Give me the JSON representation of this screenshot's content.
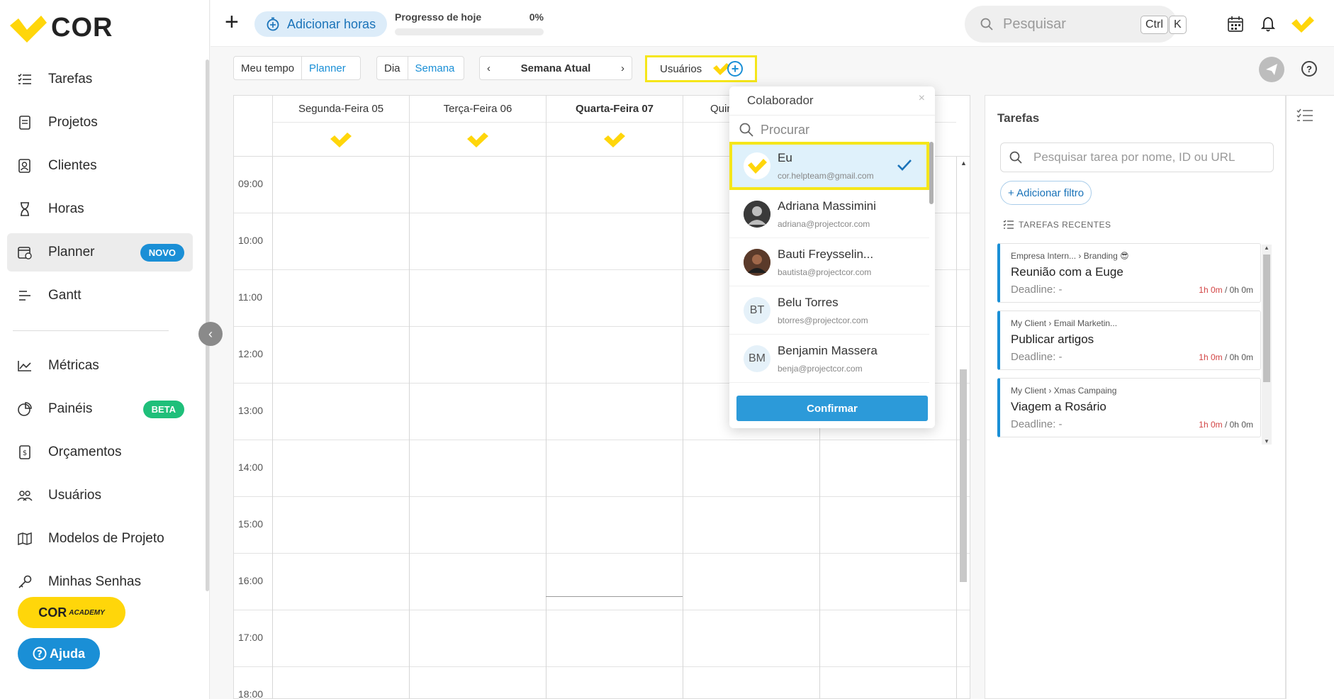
{
  "brand": {
    "name": "COR",
    "accent": "#ffd60a",
    "blue": "#1a8fd6"
  },
  "sidebar": {
    "items": [
      {
        "label": "Tarefas",
        "icon": "list-icon"
      },
      {
        "label": "Projetos",
        "icon": "document-icon"
      },
      {
        "label": "Clientes",
        "icon": "contact-icon"
      },
      {
        "label": "Horas",
        "icon": "hourglass-icon"
      },
      {
        "label": "Planner",
        "icon": "calendar-icon",
        "badge": "NOVO",
        "active": true
      },
      {
        "label": "Gantt",
        "icon": "gantt-icon"
      },
      {
        "label": "Métricas",
        "icon": "chart-icon"
      },
      {
        "label": "Painéis",
        "icon": "pie-icon",
        "badge": "BETA"
      },
      {
        "label": "Orçamentos",
        "icon": "budget-icon"
      },
      {
        "label": "Usuários",
        "icon": "users-icon"
      },
      {
        "label": "Modelos de Projeto",
        "icon": "map-icon"
      },
      {
        "label": "Minhas Senhas",
        "icon": "key-icon"
      }
    ],
    "academy_label": "COR",
    "academy_sub": "ACADEMY",
    "help_label": "Ajuda"
  },
  "topbar": {
    "add_hours": "Adicionar horas",
    "progress_label": "Progresso de hoje",
    "progress_value": "0%",
    "progress_fraction": 0,
    "search_placeholder": "Pesquisar",
    "kbd_ctrl": "Ctrl",
    "kbd_k": "K"
  },
  "toolbar": {
    "view_meu_tempo": "Meu tempo",
    "view_planner": "Planner",
    "range_dia": "Dia",
    "range_semana": "Semana",
    "week_label": "Semana Atual",
    "users_label": "Usuários"
  },
  "calendar": {
    "days": [
      "Segunda-Feira 05",
      "Terça-Feira 06",
      "Quarta-Feira 07",
      "Quin"
    ],
    "hours": [
      "09:00",
      "10:00",
      "11:00",
      "12:00",
      "13:00",
      "14:00",
      "15:00",
      "16:00",
      "17:00",
      "18:00"
    ]
  },
  "dropdown": {
    "title": "Colaborador",
    "search_placeholder": "Procurar",
    "users": [
      {
        "name": "Eu",
        "email": "cor.helpteam@gmail.com",
        "avatar": "",
        "selected": true
      },
      {
        "name": "Adriana Massimini",
        "email": "adriana@projectcor.com",
        "avatar": ""
      },
      {
        "name": "Bauti Freysselin...",
        "email": "bautista@projectcor.com",
        "avatar": ""
      },
      {
        "name": "Belu Torres",
        "email": "btorres@projectcor.com",
        "avatar": "BT"
      },
      {
        "name": "Benjamin Massera",
        "email": "benja@projectcor.com",
        "avatar": "BM"
      }
    ],
    "confirm_label": "Confirmar"
  },
  "tasks": {
    "title": "Tarefas",
    "search_placeholder": "Pesquisar tarea por nome, ID ou URL",
    "add_filter": "+ Adicionar filtro",
    "recent_label": "TAREFAS RECENTES",
    "items": [
      {
        "client": "Empresa Intern...",
        "project": "Branding 😎",
        "title": "Reunião com a Euge",
        "deadline": "Deadline: -",
        "spent": "1h 0m",
        "estimate": "/ 0h 0m"
      },
      {
        "client": "My Client",
        "project": "Email Marketin...",
        "title": "Publicar artigos",
        "deadline": "Deadline: -",
        "spent": "1h 0m",
        "estimate": "/ 0h 0m"
      },
      {
        "client": "My Client",
        "project": "Xmas Campaing",
        "title": "Viagem a Rosário",
        "deadline": "Deadline: -",
        "spent": "1h 0m",
        "estimate": "/ 0h 0m"
      }
    ]
  }
}
